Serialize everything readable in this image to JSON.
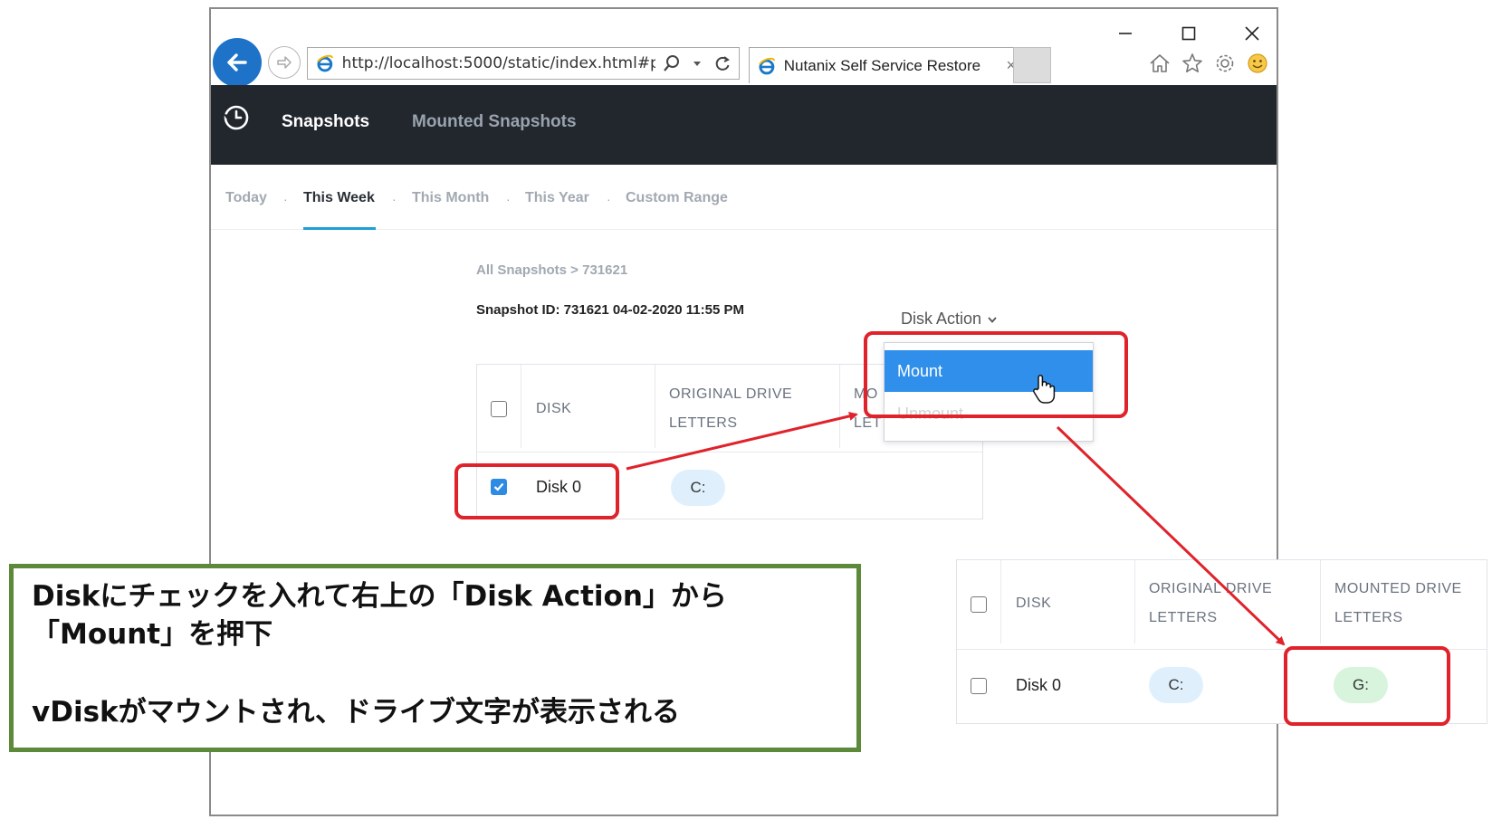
{
  "browser": {
    "url": "http://localhost:5000/static/index.html#page",
    "tab_title": "Nutanix Self Service Restore",
    "tab_close": "×"
  },
  "app": {
    "nav": [
      "Snapshots",
      "Mounted Snapshots"
    ]
  },
  "filters": [
    "Today",
    "This Week",
    "This Month",
    "This Year",
    "Custom Range"
  ],
  "filter_separator": "·",
  "breadcrumb": "All Snapshots > 731621",
  "snapshot_id": "Snapshot ID: 731621 04-02-2020 11:55 PM",
  "disk_action": "Disk Action",
  "dropdown": {
    "mount": "Mount",
    "unmount": "Unmount"
  },
  "main_table": {
    "headers": {
      "disk": "DISK",
      "original_1": "ORIGINAL DRIVE",
      "original_2": "LETTERS",
      "mounted_1": "MO",
      "mounted_2": "LET"
    },
    "row": {
      "disk": "Disk 0",
      "original": "C:",
      "checked": true
    }
  },
  "result_table": {
    "headers": {
      "disk": "DISK",
      "original_1": "ORIGINAL DRIVE",
      "original_2": "LETTERS",
      "mounted_1": "MOUNTED DRIVE",
      "mounted_2": "LETTERS"
    },
    "row": {
      "disk": "Disk 0",
      "original": "C:",
      "mounted": "G:",
      "checked": false
    }
  },
  "note": {
    "line1": "Diskにチェックを入れて右上の「Disk Action」から",
    "line2": "「Mount」を押下",
    "line3": "vDiskがマウントされ、ドライブ文字が表示される"
  },
  "colors": {
    "header_bg": "#22272e",
    "accent_blue": "#2f8fea",
    "highlight_red": "#e0222b",
    "note_border": "#5d8a3a",
    "pill_blue": "#dff0fc",
    "pill_green": "#d8f4dc"
  },
  "icons": [
    "back-arrow-icon",
    "forward-arrow-icon",
    "ie-logo-icon",
    "search-icon",
    "refresh-icon",
    "home-icon",
    "star-icon",
    "gear-icon",
    "smiley-icon",
    "history-icon",
    "chevron-down-icon",
    "hand-cursor-icon",
    "checkmark-icon"
  ]
}
